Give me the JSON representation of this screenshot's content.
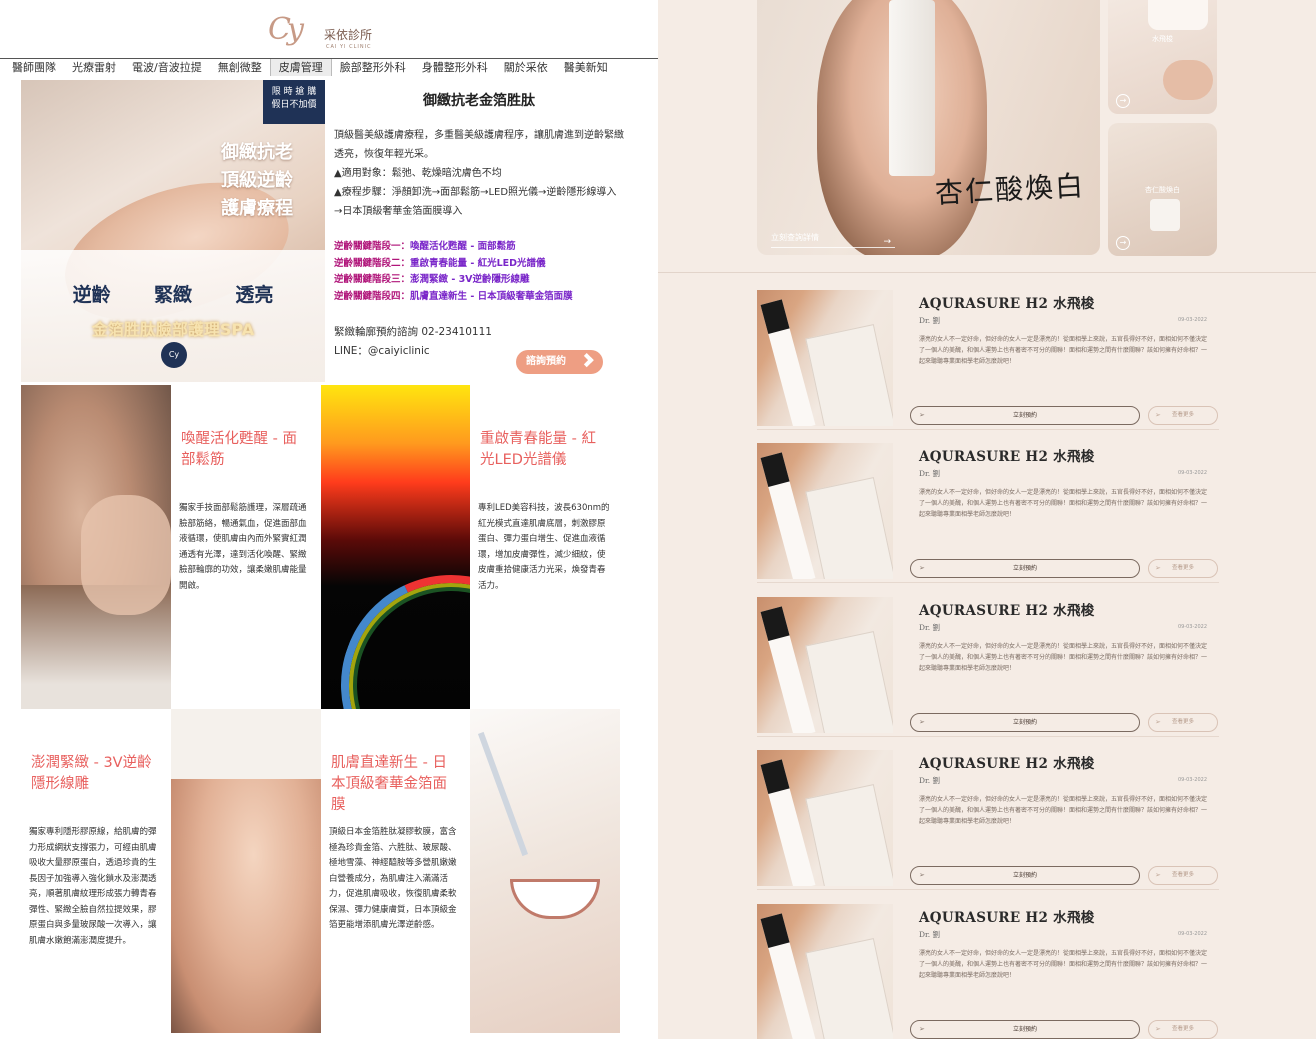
{
  "left": {
    "brand": {
      "mark": "Cy",
      "name": "采依診所",
      "en": "CAI YI CLINIC"
    },
    "nav": [
      "醫師團隊",
      "光療雷射",
      "電波/音波拉提",
      "無創微整",
      "皮膚管理",
      "臉部整形外科",
      "身體整形外科",
      "關於采依",
      "醫美新知"
    ],
    "hero": {
      "badge_line1": "限 時 搶 購",
      "badge_line2": "假日不加價",
      "headline1": "御緻抗老",
      "headline2": "頂級逆齡",
      "headline3": "護膚療程",
      "tag1": "逆齡",
      "tag2": "緊緻",
      "tag3": "透亮",
      "spa": "金箔胜肽臉部護理SPA",
      "seal": "Cy"
    },
    "product": {
      "title": "御緻抗老金箔胜肽",
      "desc1": "頂級醫美級護膚療程，多重醫美級護膚程序，讓肌膚進到逆齡緊緻透亮，恢復年輕光采。",
      "desc2": "▲適用對象：鬆弛、乾燥暗沈膚色不均",
      "desc3": "▲療程步驟：淨顏卸洗→面部鬆筋→LED照光儀→逆齡隱形線導入→日本頂級奢華金箔面膜導入",
      "stages": [
        {
          "label": "逆齡關鍵階段一：",
          "value": "喚醒活化甦醒 - 面部鬆筋"
        },
        {
          "label": "逆齡關鍵階段二：",
          "value": "重啟青春能量 - 紅光LED光譜儀"
        },
        {
          "label": "逆齡關鍵階段三：",
          "value": "澎潤緊緻 - 3V逆齡隱形線雕"
        },
        {
          "label": "逆齡關鍵階段四：",
          "value": "肌膚直達新生 - 日本頂級奢華金箔面膜"
        }
      ],
      "phone": "緊緻輪廓預約諮詢 02-23410111",
      "line": "LINE：@caiyiclinic",
      "book": "諮詢預約"
    },
    "tiles": [
      {
        "title": "喚醒活化甦醒 - 面部鬆筋",
        "body": "獨家手技面部鬆筋護理，深層疏通臉部筋絡，暢通氣血，促進面部血液循環，使肌膚由內而外緊實紅潤通透有光澤，達到活化喚醒、緊緻臉部輪廓的功效，讓柔嫩肌膚能量開啟。"
      },
      {
        "title": "重啟青春能量 - 紅光LED光譜儀",
        "body": "專利LED美容科技，波長630nm的紅光模式直達肌膚底層，刺激膠原蛋白、彈力蛋白增生、促進血液循環，增加皮膚彈性，減少細紋，使皮膚重拾健康活力光采，煥發青春活力。"
      },
      {
        "title": "澎潤緊緻 - 3V逆齡隱形線雕",
        "body": "獨家專利隱形膠原線，給肌膚的彈力形成網狀支撐張力，可經由肌膚吸收大量膠原蛋白，透過珍貴的生長因子加強導入強化鎖水及澎潤透亮，順著肌膚紋理形成張力轉青春彈性、緊緻全臉自然拉提效果，膠原蛋白與多量玻尿酸一次導入，讓肌膚水嫩飽滿澎潤度提升。"
      },
      {
        "title": "肌膚直達新生 - 日本頂級奢華金箔面膜",
        "body": "頂級日本金箔胜肽凝膠軟膜，富含極為珍貴金箔、六胜肽、玻尿酸、極地雪藻、神經醯胺等多營肌嫩嫩白營養成分，為肌膚注入滿滿活力，促進肌膚吸收，恢復肌膚柔軟保濕、彈力健康膚質，日本頂級金箔更能增添肌膚光澤逆齡感。"
      }
    ]
  },
  "right": {
    "featured": {
      "script_text": "杏仁酸煥白",
      "details_link": "立刻查詢詳情",
      "card_a": "水飛梭",
      "card_b": "杏仁酸煥白"
    },
    "posts": [
      {
        "title": "AQURASURE H2 水飛梭",
        "author": "Dr. 劉",
        "date": "09-03-2022",
        "excerpt": "漂亮的女人不一定好命，但好命的女人一定是漂亮的！從面相學上來說，五官長得好不好，面相如何不僅決定了一個人的美醜，和個人運勢上也有著密不可分的關聯！面相和運勢之間有什麼關聯？該如何擁有好命相？一起來聽聽專業面相學老師怎麼說吧！",
        "book": "立刻預約",
        "more": "查看更多"
      },
      {
        "title": "AQURASURE H2 水飛梭",
        "author": "Dr. 劉",
        "date": "09-03-2022",
        "excerpt": "漂亮的女人不一定好命，但好命的女人一定是漂亮的！從面相學上來說，五官長得好不好，面相如何不僅決定了一個人的美醜，和個人運勢上也有著密不可分的關聯！面相和運勢之間有什麼關聯？該如何擁有好命相？一起來聽聽專業面相學老師怎麼說吧！",
        "book": "立刻預約",
        "more": "查看更多"
      },
      {
        "title": "AQURASURE H2 水飛梭",
        "author": "Dr. 劉",
        "date": "09-03-2022",
        "excerpt": "漂亮的女人不一定好命，但好命的女人一定是漂亮的！從面相學上來說，五官長得好不好，面相如何不僅決定了一個人的美醜，和個人運勢上也有著密不可分的關聯！面相和運勢之間有什麼關聯？該如何擁有好命相？一起來聽聽專業面相學老師怎麼說吧！",
        "book": "立刻預約",
        "more": "查看更多"
      },
      {
        "title": "AQURASURE H2 水飛梭",
        "author": "Dr. 劉",
        "date": "09-03-2022",
        "excerpt": "漂亮的女人不一定好命，但好命的女人一定是漂亮的！從面相學上來說，五官長得好不好，面相如何不僅決定了一個人的美醜，和個人運勢上也有著密不可分的關聯！面相和運勢之間有什麼關聯？該如何擁有好命相？一起來聽聽專業面相學老師怎麼說吧！",
        "book": "立刻預約",
        "more": "查看更多"
      },
      {
        "title": "AQURASURE H2 水飛梭",
        "author": "Dr. 劉",
        "date": "09-03-2022",
        "excerpt": "漂亮的女人不一定好命，但好命的女人一定是漂亮的！從面相學上來說，五官長得好不好，面相如何不僅決定了一個人的美醜，和個人運勢上也有著密不可分的關聯！面相和運勢之間有什麼關聯？該如何擁有好命相？一起來聽聽專業面相學老師怎麼說吧！",
        "book": "立刻預約",
        "more": "查看更多"
      }
    ]
  }
}
